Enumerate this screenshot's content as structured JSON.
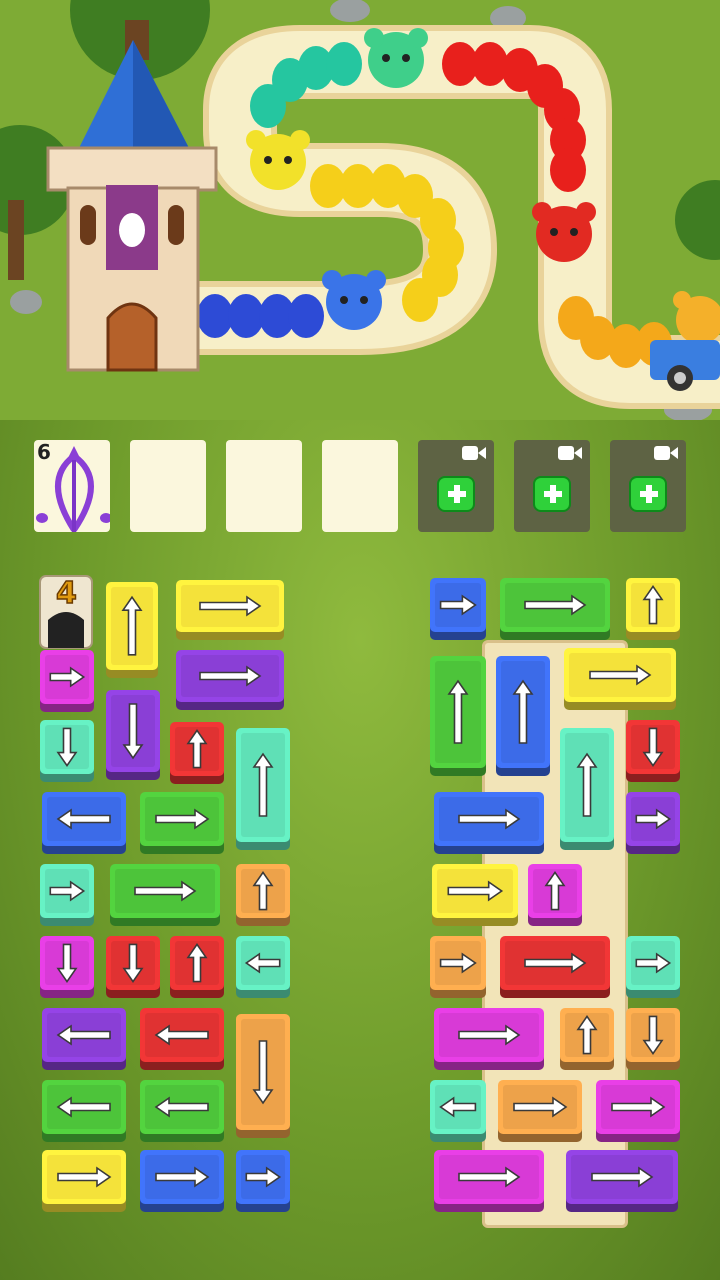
{
  "bow": {
    "count": "6",
    "icon": "bow-arrow-icon"
  },
  "slots": [
    {
      "kind": "bow"
    },
    {
      "kind": "empty"
    },
    {
      "kind": "empty"
    },
    {
      "kind": "empty"
    },
    {
      "kind": "locked",
      "icons": [
        "video-icon",
        "plus-icon"
      ]
    },
    {
      "kind": "locked",
      "icons": [
        "video-icon",
        "plus-icon"
      ]
    },
    {
      "kind": "locked",
      "icons": [
        "video-icon",
        "plus-icon"
      ]
    }
  ],
  "tunnel": {
    "count": "4"
  },
  "colors": {
    "yellow": "#f4e23a",
    "purple": "#8a3fd6",
    "magenta": "#d83ad6",
    "teal": "#5fe0b6",
    "red": "#e03232",
    "blue": "#3c6be8",
    "green": "#4dc43a",
    "orange": "#eda24a"
  },
  "left_tiles": [
    {
      "color": "yellow",
      "dir": "up"
    },
    {
      "color": "yellow",
      "dir": "right"
    },
    {
      "color": "magenta",
      "dir": "right"
    },
    {
      "color": "purple",
      "dir": "right"
    },
    {
      "color": "teal",
      "dir": "down"
    },
    {
      "color": "purple",
      "dir": "down"
    },
    {
      "color": "red",
      "dir": "up"
    },
    {
      "color": "teal",
      "dir": "up"
    },
    {
      "color": "blue",
      "dir": "left"
    },
    {
      "color": "green",
      "dir": "right"
    },
    {
      "color": "teal",
      "dir": "right"
    },
    {
      "color": "green",
      "dir": "right"
    },
    {
      "color": "orange",
      "dir": "up"
    },
    {
      "color": "magenta",
      "dir": "down"
    },
    {
      "color": "red",
      "dir": "down"
    },
    {
      "color": "red",
      "dir": "up"
    },
    {
      "color": "teal",
      "dir": "left"
    },
    {
      "color": "purple",
      "dir": "left"
    },
    {
      "color": "red",
      "dir": "left"
    },
    {
      "color": "orange",
      "dir": "down"
    },
    {
      "color": "green",
      "dir": "left"
    },
    {
      "color": "green",
      "dir": "left"
    },
    {
      "color": "yellow",
      "dir": "right"
    },
    {
      "color": "blue",
      "dir": "right"
    },
    {
      "color": "blue",
      "dir": "right"
    }
  ],
  "right_tiles": [
    {
      "color": "blue",
      "dir": "right"
    },
    {
      "color": "green",
      "dir": "right"
    },
    {
      "color": "yellow",
      "dir": "up"
    },
    {
      "color": "green",
      "dir": "up"
    },
    {
      "color": "blue",
      "dir": "up"
    },
    {
      "color": "yellow",
      "dir": "right"
    },
    {
      "color": "teal",
      "dir": "up"
    },
    {
      "color": "red",
      "dir": "down"
    },
    {
      "color": "blue",
      "dir": "right"
    },
    {
      "color": "purple",
      "dir": "right"
    },
    {
      "color": "yellow",
      "dir": "right"
    },
    {
      "color": "magenta",
      "dir": "up"
    },
    {
      "color": "orange",
      "dir": "right"
    },
    {
      "color": "red",
      "dir": "right"
    },
    {
      "color": "teal",
      "dir": "right"
    },
    {
      "color": "magenta",
      "dir": "right"
    },
    {
      "color": "orange",
      "dir": "up"
    },
    {
      "color": "orange",
      "dir": "down"
    },
    {
      "color": "teal",
      "dir": "left"
    },
    {
      "color": "orange",
      "dir": "right"
    },
    {
      "color": "magenta",
      "dir": "right"
    },
    {
      "color": "magenta",
      "dir": "right"
    },
    {
      "color": "purple",
      "dir": "right"
    }
  ]
}
